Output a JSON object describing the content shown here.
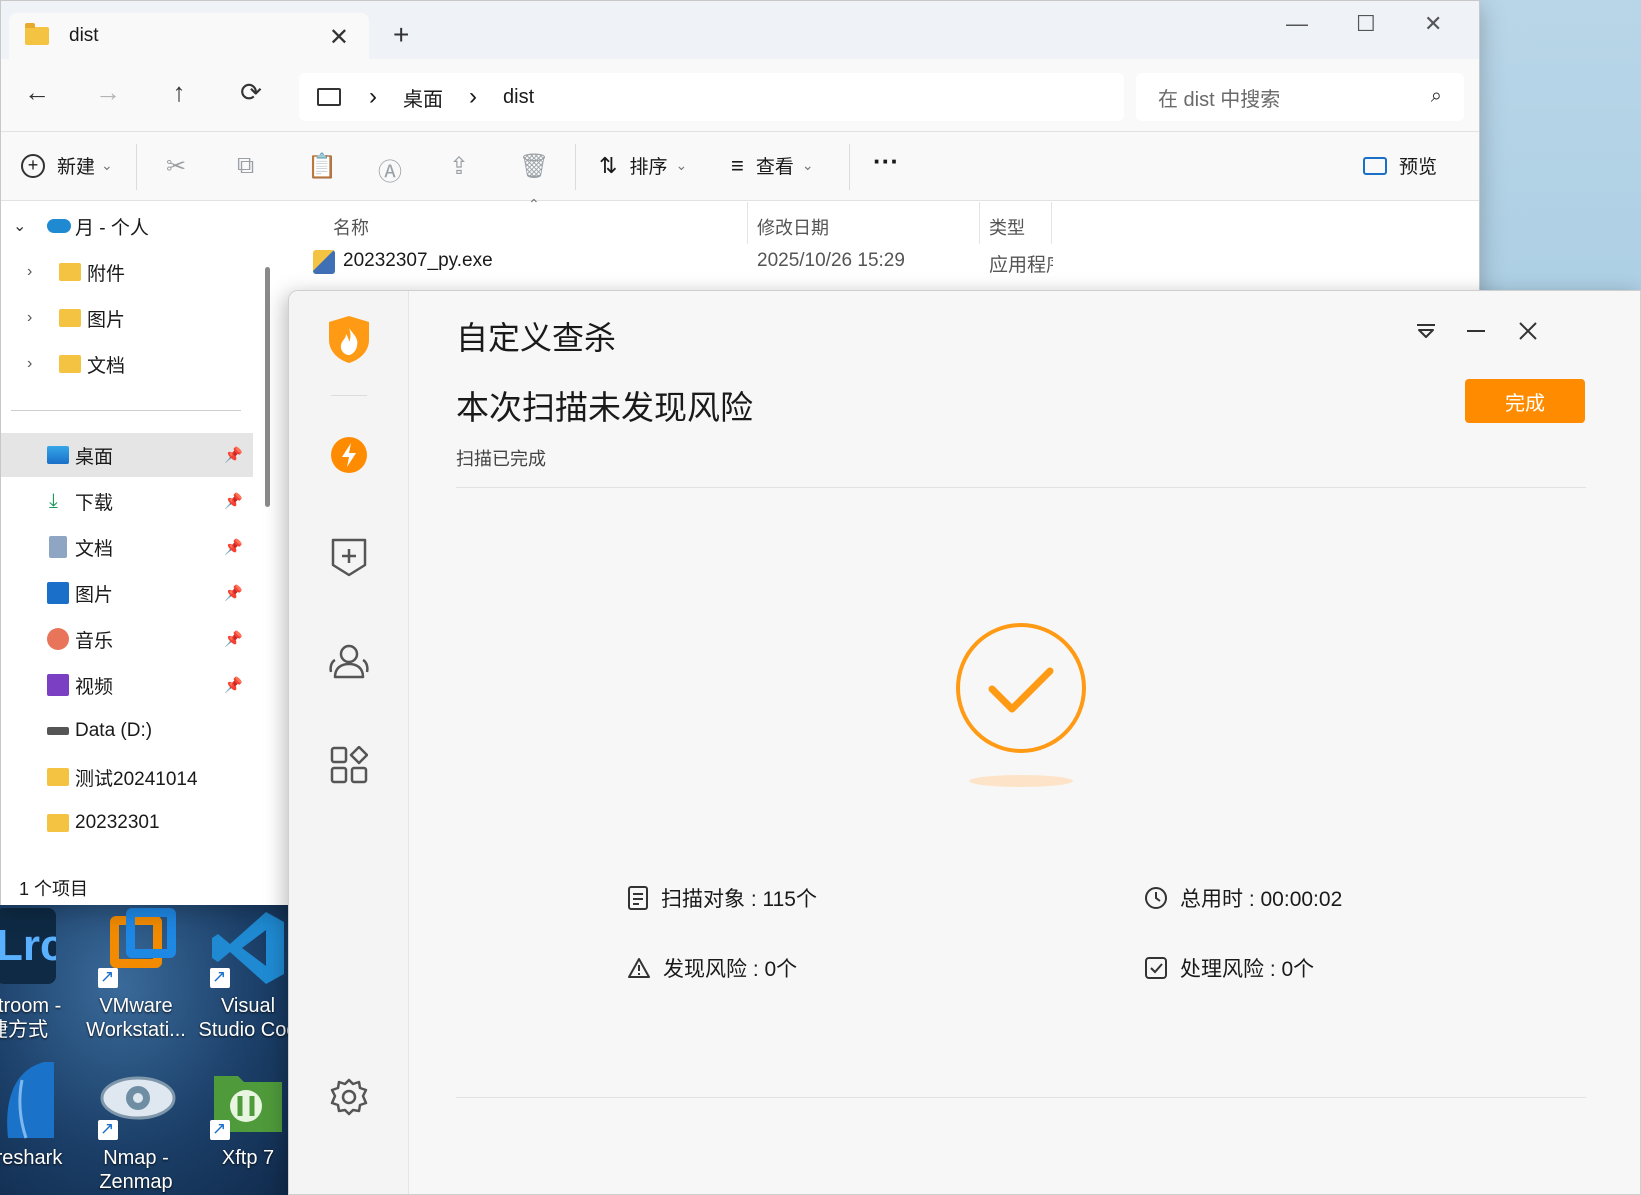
{
  "explorer": {
    "tab_title": "dist",
    "tab_close": "✕",
    "new_tab": "+",
    "window_controls": {
      "minimize": "—",
      "maximize": "☐",
      "close": "✕"
    },
    "nav_buttons": {
      "back": "←",
      "forward": "→",
      "up": "↑",
      "refresh": "⟳"
    },
    "breadcrumb": [
      "桌面",
      "dist"
    ],
    "breadcrumb_sep": "›",
    "search_placeholder": "在 dist 中搜索",
    "toolbar": {
      "new_label": "新建",
      "sort_label": "排序",
      "view_label": "查看",
      "more_label": "···",
      "preview_label": "预览",
      "caret": "⌄"
    },
    "nav_tree": {
      "onedrive": "月 - 个人",
      "onedrive_children": [
        "附件",
        "图片",
        "文档"
      ],
      "quick_access": [
        {
          "label": "桌面",
          "icon": "desktop-icon",
          "pinned": true,
          "selected": true
        },
        {
          "label": "下载",
          "icon": "download-icon",
          "pinned": true
        },
        {
          "label": "文档",
          "icon": "documents-icon",
          "pinned": true
        },
        {
          "label": "图片",
          "icon": "pictures-icon",
          "pinned": true
        },
        {
          "label": "音乐",
          "icon": "music-icon",
          "pinned": true
        },
        {
          "label": "视频",
          "icon": "videos-icon",
          "pinned": true
        },
        {
          "label": "Data (D:)",
          "icon": "drive-icon",
          "pinned": false
        },
        {
          "label": "测试20241014",
          "icon": "folder-icon",
          "pinned": false
        },
        {
          "label": "20232301",
          "icon": "folder-icon",
          "pinned": false
        }
      ]
    },
    "columns": {
      "name": "名称",
      "modified": "修改日期",
      "type": "类型"
    },
    "files": [
      {
        "name": "20232307_py.exe",
        "modified": "2025/10/26 15:29",
        "type": "应用程序"
      }
    ],
    "status": "1 个项目"
  },
  "scanner": {
    "title": "自定义查杀",
    "headline": "本次扫描未发现风险",
    "subtitle": "扫描已完成",
    "done_button": "完成",
    "brand_color": "#ff8c00",
    "stats": {
      "scanned": "扫描对象 : 115个",
      "elapsed": "总用时 : 00:00:02",
      "risks_found": "发现风险 : 0个",
      "risks_handled": "处理风险 : 0个"
    }
  },
  "desktop_icons": [
    {
      "label_line1": "ntroom -",
      "label_line2": "捷方式",
      "icon": "lightroom-icon"
    },
    {
      "label_line1": "VMware",
      "label_line2": "Workstati...",
      "icon": "vmware-icon"
    },
    {
      "label_line1": "Visual",
      "label_line2": "Studio Cod",
      "icon": "vscode-icon"
    },
    {
      "label_line1": "reshark",
      "label_line2": "",
      "icon": "wireshark-icon"
    },
    {
      "label_line1": "Nmap -",
      "label_line2": "Zenmap GUI",
      "icon": "nmap-icon"
    },
    {
      "label_line1": "Xftp 7",
      "label_line2": "",
      "icon": "xftp-icon"
    }
  ]
}
